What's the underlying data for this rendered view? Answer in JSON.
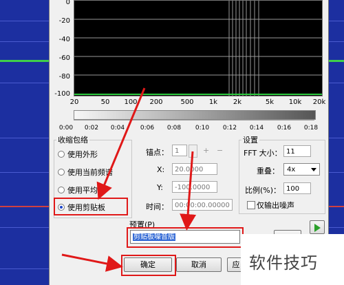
{
  "spectrum": {
    "y_labels": [
      "0",
      "-20",
      "-40",
      "-60",
      "-80",
      "-100"
    ],
    "x_labels": [
      "20",
      "50",
      "100",
      "200",
      "500",
      "1k",
      "2k",
      "5k",
      "10k",
      "20k"
    ],
    "time_labels": [
      "0:00",
      "0:02",
      "0:04",
      "0:06",
      "0:08",
      "0:10",
      "0:12",
      "0:14",
      "0:16",
      "0:18"
    ]
  },
  "envelope_group": {
    "title": "收缩包络",
    "options": [
      "使用外形",
      "使用当前频谱",
      "使用平均值",
      "使用剪贴板"
    ],
    "selected_index": 3
  },
  "anchor": {
    "anchor_label": "锚点：",
    "anchor_value": "1",
    "x_label": "X:",
    "x_value": "20.0000",
    "y_label": "Y:",
    "y_value": "-100.0000",
    "time_label": "时间：",
    "time_value": "00:00:00.00000"
  },
  "settings": {
    "title": "设置",
    "fft_label": "FFT 大小：",
    "fft_value": "11",
    "overlap_label": "重叠：",
    "overlap_value": "4x",
    "ratio_label": "比例(%)：",
    "ratio_value": "100",
    "noise_only_label": "仅输出噪声"
  },
  "preset": {
    "label": "预置(P)",
    "value": "剪贴板噪音版"
  },
  "buttons": {
    "ok": "确定",
    "cancel": "取消",
    "partial": "应"
  },
  "watermark": "软件技巧"
}
